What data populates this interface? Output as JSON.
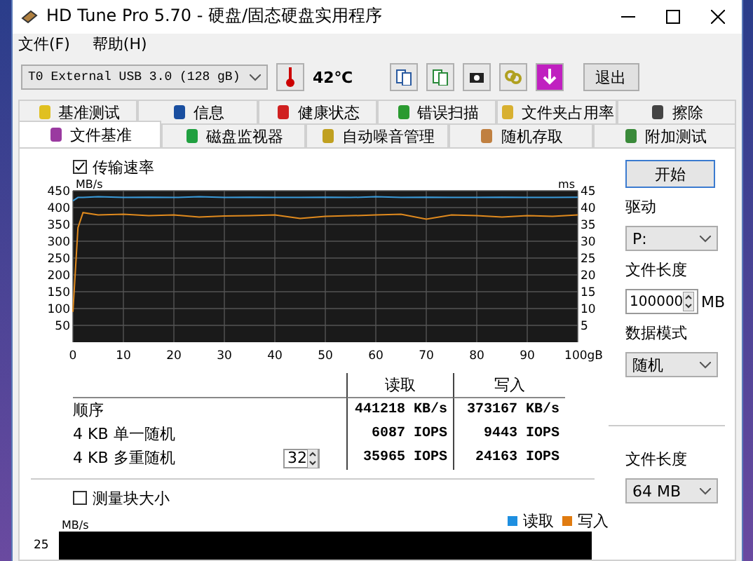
{
  "window": {
    "title": "HD Tune Pro 5.70 - 硬盘/固态硬盘实用程序"
  },
  "menu": [
    "文件(F)",
    "帮助(H)"
  ],
  "toolbar": {
    "drive": "T0 External USB 3.0 (128 gB)",
    "temperature": "42℃",
    "exit_button": "退出"
  },
  "tabs_top": [
    {
      "label": "基准测试",
      "selected": false
    },
    {
      "label": "信息",
      "selected": false
    },
    {
      "label": "健康状态",
      "selected": false
    },
    {
      "label": "错误扫描",
      "selected": false
    },
    {
      "label": "文件夹占用率",
      "selected": false
    },
    {
      "label": "擦除",
      "selected": false
    }
  ],
  "tabs_bottom": [
    {
      "label": "文件基准",
      "selected": true
    },
    {
      "label": "磁盘监视器",
      "selected": false
    },
    {
      "label": "自动噪音管理",
      "selected": false
    },
    {
      "label": "随机存取",
      "selected": false
    },
    {
      "label": "附加测试",
      "selected": false
    }
  ],
  "transfer_rate": {
    "label": "传输速率",
    "checked": true,
    "chart_data": {
      "type": "line",
      "ylabel": "MB/s",
      "y2label": "ms",
      "xlim": [
        0,
        100
      ],
      "ylim": [
        0,
        450
      ],
      "xticks": [
        0,
        10,
        20,
        30,
        40,
        50,
        60,
        70,
        80,
        90,
        {
          "value": 100,
          "label": "100gB"
        }
      ],
      "yticks": [
        50,
        100,
        150,
        200,
        250,
        300,
        350,
        400,
        450
      ],
      "y2ticks": [
        5,
        10,
        15,
        20,
        25,
        30,
        35,
        40,
        45
      ],
      "y2lim": [
        0,
        45
      ],
      "grid": true,
      "x": [
        0,
        1,
        2,
        5,
        10,
        15,
        20,
        25,
        30,
        35,
        40,
        45,
        50,
        55,
        60,
        65,
        70,
        75,
        80,
        85,
        90,
        95,
        100
      ],
      "series": [
        {
          "color": "#3a9ad9",
          "values": [
            420,
            430,
            430,
            432,
            430,
            431,
            430,
            432,
            430,
            431,
            430,
            430,
            431,
            430,
            432,
            430,
            431,
            430,
            430,
            431,
            430,
            430,
            431
          ]
        },
        {
          "color": "#e08a1e",
          "values": [
            90,
            340,
            385,
            378,
            380,
            376,
            378,
            372,
            375,
            376,
            378,
            368,
            374,
            376,
            378,
            380,
            366,
            378,
            376,
            372,
            376,
            374,
            378
          ]
        }
      ]
    }
  },
  "results": {
    "columns": [
      "读取",
      "写入"
    ],
    "rows": [
      {
        "label": "顺序",
        "read": "441218 KB/s",
        "write": "373167 KB/s"
      },
      {
        "label": "4 KB 单一随机",
        "read": "6087 IOPS",
        "write": "9443 IOPS"
      },
      {
        "label": "4 KB 多重随机",
        "queue": "32",
        "read": "35965 IOPS",
        "write": "24163 IOPS"
      }
    ]
  },
  "block_size": {
    "label": "测量块大小",
    "checked": false,
    "ylabel": "MB/s",
    "tick": "25",
    "legend": [
      {
        "label": "读取",
        "color": "#1e8fe0"
      },
      {
        "label": "写入",
        "color": "#e07b10"
      }
    ]
  },
  "side": {
    "start_button": "开始",
    "drive_label": "驱动",
    "drive": "P:",
    "file_length_label": "文件长度",
    "file_length": "100000",
    "unit": "MB",
    "data_mode_label": "数据模式",
    "data_mode": "随机",
    "file_length_label_2": "文件长度",
    "file_length_2": "64 MB"
  }
}
